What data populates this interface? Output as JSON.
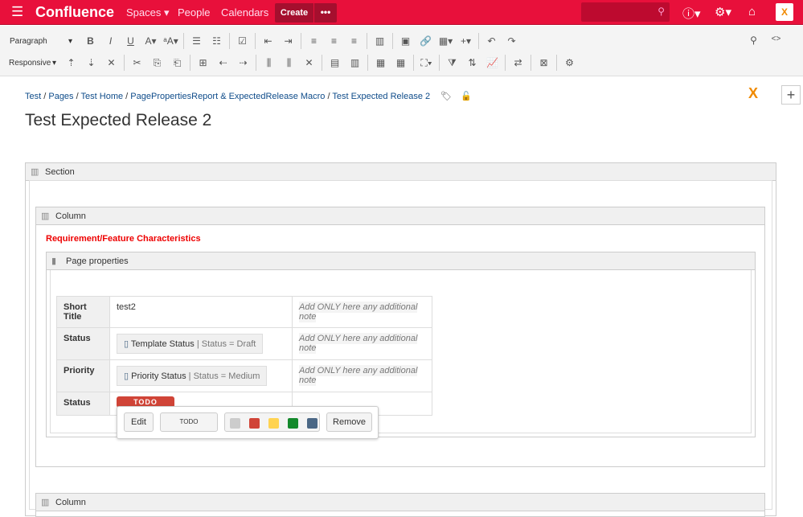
{
  "header": {
    "logo": "Confluence",
    "nav": [
      "Spaces ▾",
      "People",
      "Calendars"
    ],
    "create": "Create",
    "more": "•••"
  },
  "toolbar": {
    "paragraph": "Paragraph",
    "responsive": "Responsive",
    "row1": [
      "bold-icon:B",
      "italic-icon:I",
      "underline-icon:U",
      "text-color-icon:A▾",
      "text-size-icon:ᵃA▾",
      "|",
      "bullet-list-icon:☰",
      "numbered-list-icon:☷",
      "|",
      "task-list-icon:☑",
      "|",
      "outdent-icon:⇤",
      "indent-icon:⇥",
      "|",
      "align-left-icon:≡",
      "align-center-icon:≡",
      "align-right-icon:≡",
      "|",
      "layout-icon:▥",
      "|",
      "image-icon:▣",
      "link-icon:🔗",
      "table-icon:▦▾",
      "insert-icon:+▾",
      "|",
      "undo-icon:↶",
      "redo-icon:↷"
    ],
    "row2": [
      "row-above-icon:⇡",
      "row-below-icon:⇣",
      "delete-row-icon:✕",
      "|",
      "cut-row-icon:✂",
      "copy-row-icon:⎘",
      "paste-row-icon:⎗",
      "|",
      "merge-icon:⊞",
      "col-before-icon:⇠",
      "col-after-icon:⇢",
      "|",
      "insert-col-before-icon:⫼",
      "insert-col-after-icon:⫼",
      "delete-col-icon:✕",
      "|",
      "header-row-icon:▤",
      "header-col-icon:▥",
      "|",
      "table-props-icon:▦",
      "table-width-icon:▦",
      "|",
      "table-size-icon:⛶▾",
      "|",
      "filter-icon:⧩",
      "sort-icon:⇅",
      "chart-icon:📈",
      "|",
      "transpose-icon:⇄",
      "|",
      "delete-table-icon:⊠",
      "|",
      "settings-icon:⚙"
    ]
  },
  "breadcrumb": [
    "Test",
    "Pages",
    "Test Home",
    "PagePropertiesReport & ExpectedRelease Macro",
    "Test Expected Release 2"
  ],
  "title": "Test Expected Release 2",
  "section": {
    "label": "Section"
  },
  "column": {
    "label": "Column"
  },
  "heading": "Requirement/Feature Characteristics",
  "page_properties": {
    "label": "Page properties"
  },
  "table": {
    "rows": [
      {
        "key": "Short Title",
        "value": "test2",
        "note": "Add ONLY here any additional note"
      },
      {
        "key": "Status",
        "macro": "Template Status",
        "macro_param": "| Status = Draft",
        "note": "Add ONLY here any additional note"
      },
      {
        "key": "Priority",
        "macro": "Priority Status",
        "macro_param": "| Status = Medium",
        "note": "Add ONLY here any additional note"
      },
      {
        "key": "Status",
        "lozenge": "TODO"
      }
    ]
  },
  "popup": {
    "edit": "Edit",
    "text": "TODO",
    "remove": "Remove",
    "colors": [
      "#cccccc",
      "#d04437",
      "#ffd351",
      "#14892c",
      "#4a6785"
    ]
  },
  "column2": {
    "label": "Column"
  }
}
